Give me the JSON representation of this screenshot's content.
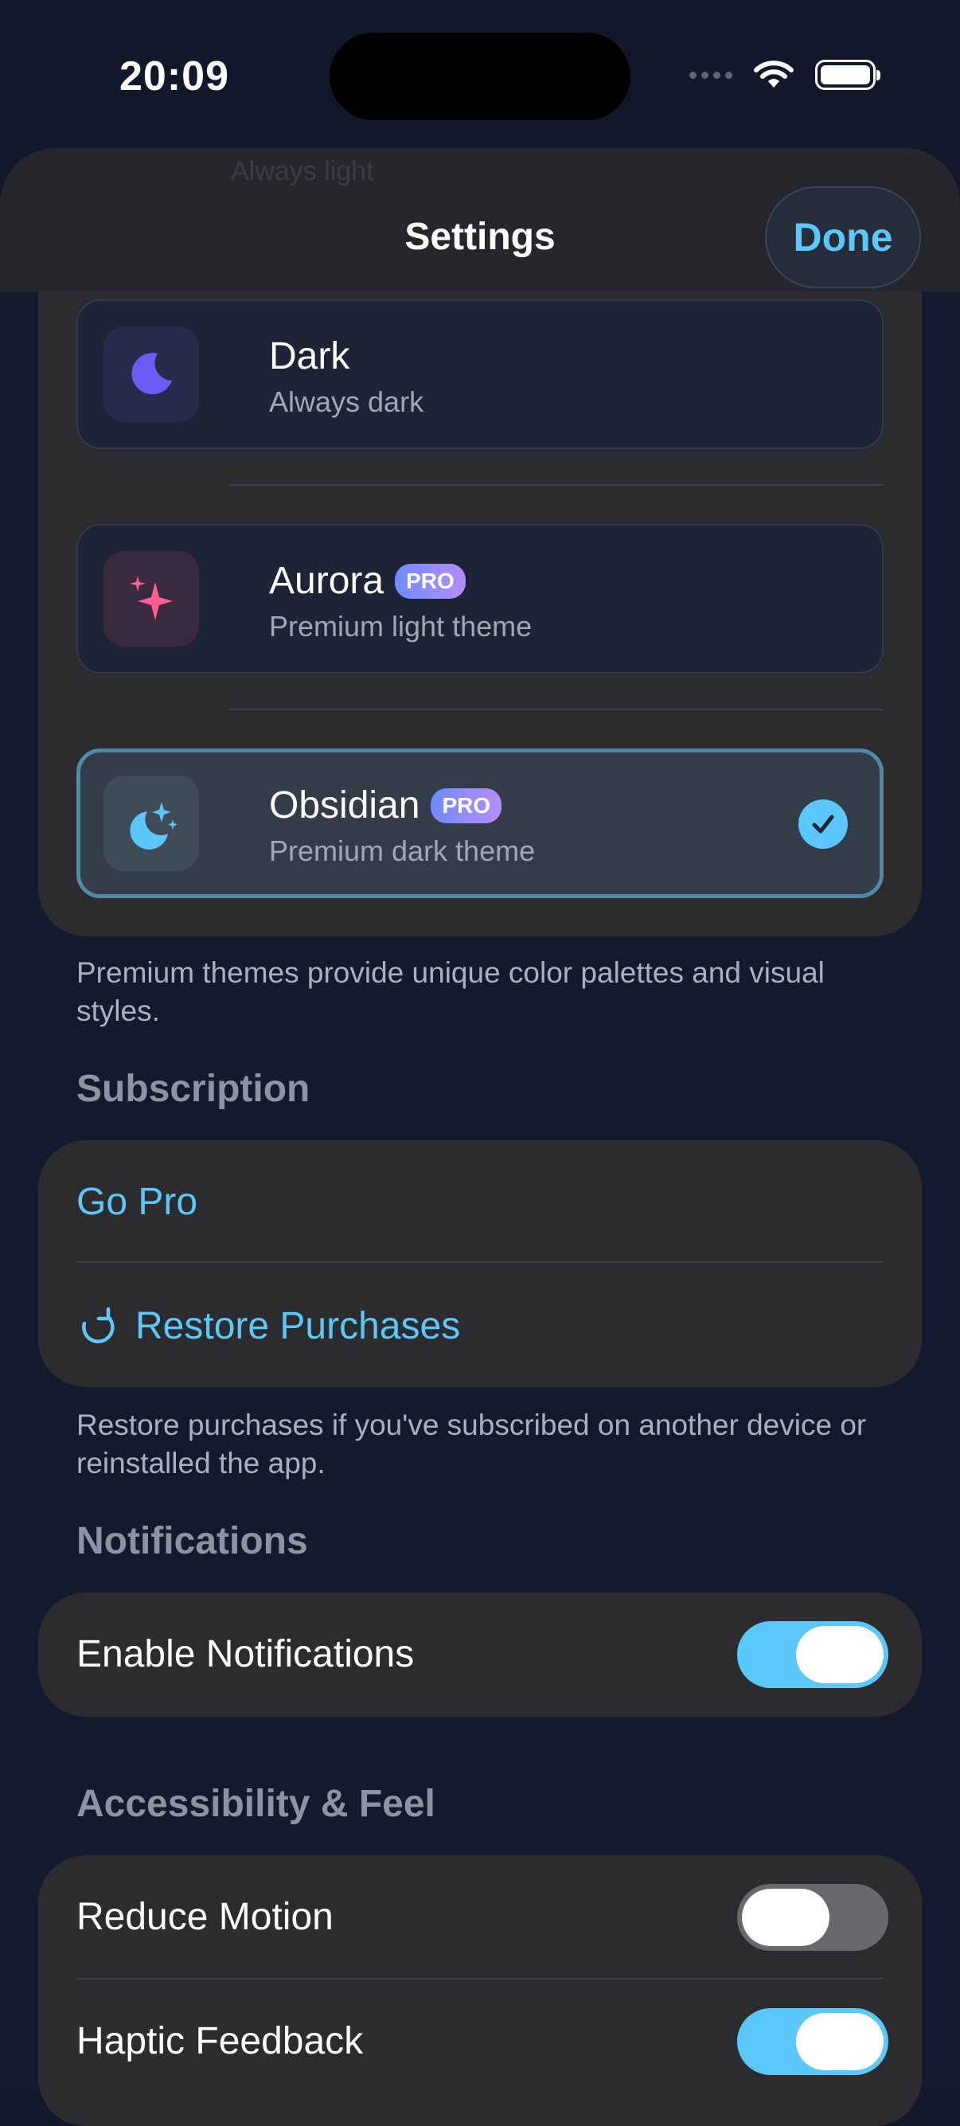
{
  "status": {
    "time": "20:09"
  },
  "header": {
    "title": "Settings",
    "done_label": "Done",
    "ghost_subtitle": "Always light"
  },
  "themes": [
    {
      "name": "Dark",
      "desc": "Always dark",
      "pro": "",
      "icon": "moon-icon"
    },
    {
      "name": "Aurora",
      "desc": "Premium light theme",
      "pro": "PRO",
      "icon": "sparkles-icon"
    },
    {
      "name": "Obsidian",
      "desc": "Premium dark theme",
      "pro": "PRO",
      "icon": "moon-stars-icon",
      "selected": true
    }
  ],
  "themes_footnote": "Premium themes provide unique color palettes and visual styles.",
  "subscription": {
    "title": "Subscription",
    "go_pro": "Go Pro",
    "restore": "Restore Purchases",
    "footnote": "Restore purchases if you've subscribed on another device or reinstalled the app."
  },
  "notifications": {
    "title": "Notifications",
    "enable_label": "Enable Notifications",
    "enabled": true
  },
  "accessibility": {
    "title": "Accessibility & Feel",
    "reduce_motion_label": "Reduce Motion",
    "reduce_motion": false,
    "haptic_label": "Haptic Feedback",
    "haptic": true
  },
  "colors": {
    "accent": "#5ac8fa",
    "toggle_off": "#68686d",
    "pro_badge_start": "#6f8bff",
    "pro_badge_end": "#b58cff"
  }
}
